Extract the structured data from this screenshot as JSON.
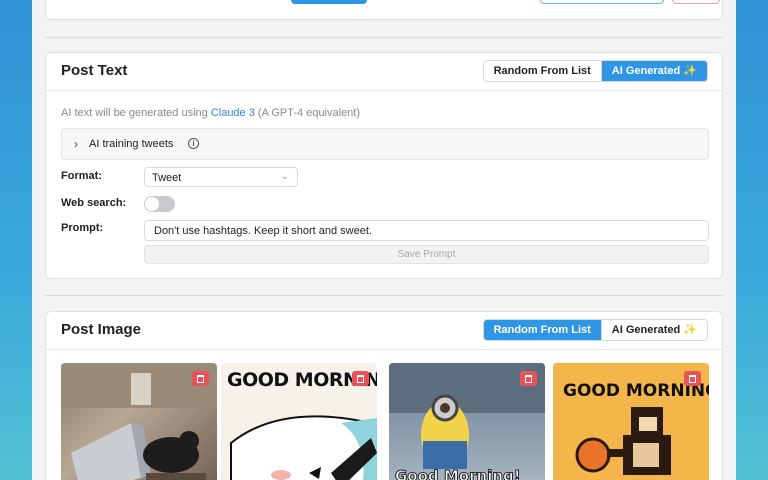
{
  "post_text": {
    "title": "Post Text",
    "toggle": {
      "option1": "Random From List",
      "option2": "AI Generated ✨",
      "active": "option2"
    },
    "note_prefix": "AI text will be generated using ",
    "note_link": "Claude 3",
    "note_suffix": " (A GPT-4 equivalent)",
    "accordion_label": "AI training tweets",
    "format_label": "Format:",
    "format_value": "Tweet",
    "web_search_label": "Web search:",
    "prompt_label": "Prompt:",
    "prompt_value": "Don't use hashtags. Keep it short and sweet.",
    "save_label": "Save Prompt"
  },
  "post_image": {
    "title": "Post Image",
    "toggle": {
      "option1": "Random From List",
      "option2": "AI Generated ✨",
      "active": "option1"
    },
    "images": [
      {
        "caption": ""
      },
      {
        "caption": "GOOD MORNING"
      },
      {
        "caption": "Good Morning!"
      },
      {
        "caption": "GOOD MORNING"
      }
    ]
  },
  "colors": {
    "accent": "#2f96e6",
    "delete": "#e8535a",
    "link": "#2f83cf"
  }
}
